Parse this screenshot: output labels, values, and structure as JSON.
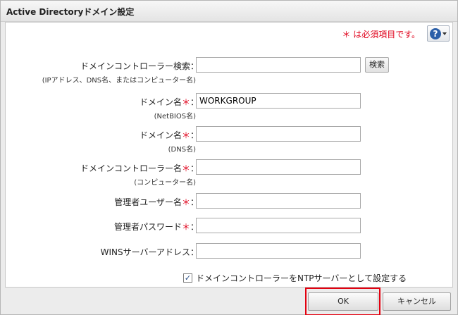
{
  "dialog": {
    "title": "Active Directoryドメイン設定"
  },
  "header": {
    "required_note": "＊ は必須項目です。",
    "help_symbol": "?"
  },
  "fields": [
    {
      "label": "ドメインコントローラー検索：",
      "required": false,
      "sublabel": "(IPアドレス、DNS名、またはコンピューター名)",
      "value": ""
    },
    {
      "label": "ドメイン名",
      "required": true,
      "sublabel": "(NetBIOS名)",
      "value": "WORKGROUP"
    },
    {
      "label": "ドメイン名",
      "required": true,
      "sublabel": "(DNS名)",
      "value": ""
    },
    {
      "label": "ドメインコントローラー名",
      "required": true,
      "sublabel": "(コンピューター名)",
      "value": ""
    },
    {
      "label": "管理者ユーザー名",
      "required": true,
      "sublabel": "",
      "value": ""
    },
    {
      "label": "管理者パスワード",
      "required": true,
      "sublabel": "",
      "value": ""
    },
    {
      "label": "WINSサーバーアドレス：",
      "required": false,
      "sublabel": "",
      "value": ""
    }
  ],
  "required_marker": "＊",
  "colon": "：",
  "search_button": "検索",
  "ntp_checkbox": {
    "label": "ドメインコントローラーをNTPサーバーとして設定する",
    "checked": true,
    "mark": "✓"
  },
  "buttons": {
    "ok": "OK",
    "cancel": "キャンセル"
  },
  "colors": {
    "required": "#e0001a",
    "highlight": "#e3000f",
    "help": "#2b5fa8"
  }
}
